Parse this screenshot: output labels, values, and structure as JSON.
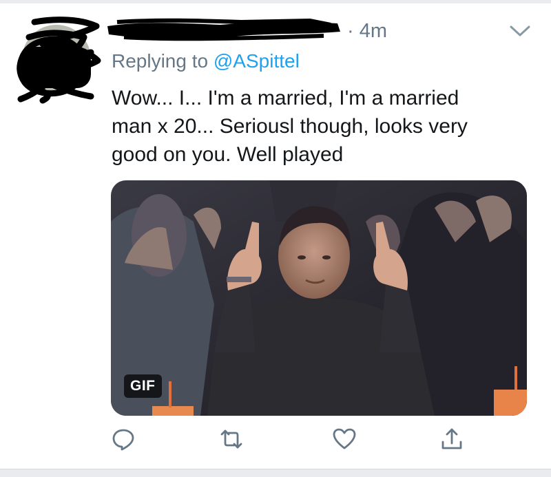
{
  "tweet": {
    "author_name": "",
    "timestamp": "· 4m",
    "reply_prefix": "Replying to ",
    "reply_handle": "@ASpittel",
    "text_lines": [
      "Wow... I...  I'm a married, I'm a married",
      "man x 20...  Seriousl though, looks very",
      "good on you.   Well played"
    ],
    "media": {
      "type": "GIF",
      "badge": "GIF"
    }
  },
  "actions": {
    "reply": "reply-icon",
    "retweet": "retweet-icon",
    "like": "heart-icon",
    "share": "share-icon"
  },
  "colors": {
    "text": "#14171a",
    "secondary": "#657786",
    "link": "#1da1f2",
    "divider": "#e9ebee"
  }
}
